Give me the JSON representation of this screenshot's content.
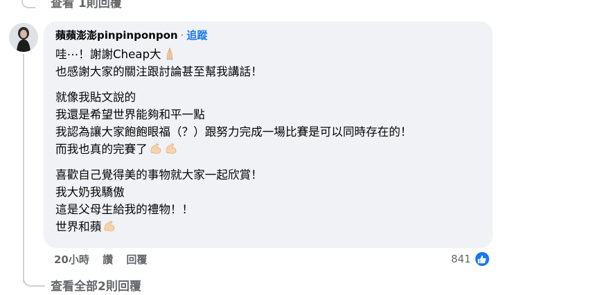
{
  "top_reply_link": "查看 1則回覆",
  "comment": {
    "author": "蘋蘋澎澎pinpinponpon",
    "separator": "·",
    "follow_label": "追蹤",
    "lines": [
      "哇⋯！謝謝Cheap大",
      "也感謝大家的關注跟討論甚至幫我講話！",
      "就像我貼文說的",
      "我還是希望世界能夠和平一點",
      "我認為讓大家飽飽眼福（？）跟努力完成一場比賽是可以同時存在的！",
      "而我也真的完賽了",
      "喜歡自己覺得美的事物就大家一起欣賞！",
      "我大奶我驕傲",
      "這是父母生給我的禮物！！",
      "世界和蘋"
    ],
    "emojis": {
      "line_1": "folded-hands",
      "line_6": "flexed-biceps ×2",
      "line_10": "flexed-biceps"
    }
  },
  "actions": {
    "time": "20小時",
    "like_label": "讚",
    "reply_label": "回覆"
  },
  "reactions": {
    "count": "841",
    "type": "like"
  },
  "view_all_replies": "查看全部2則回覆",
  "colors": {
    "bubble_bg": "#f0f2f5",
    "link_blue": "#1877f2",
    "meta_gray": "#65676b",
    "text": "#050505"
  }
}
